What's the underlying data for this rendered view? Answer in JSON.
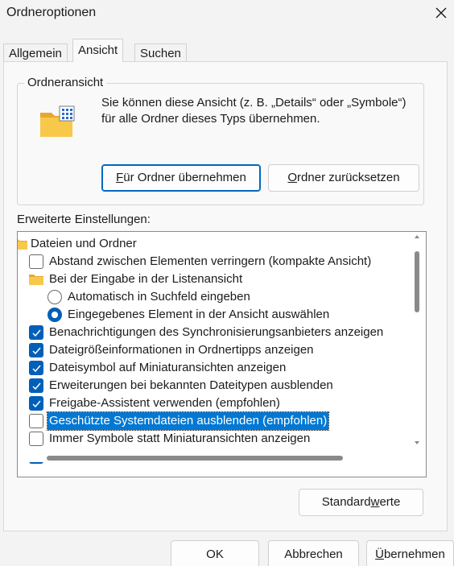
{
  "window": {
    "title": "Ordneroptionen"
  },
  "tabs": [
    {
      "label": "Allgemein"
    },
    {
      "label": "Ansicht"
    },
    {
      "label": "Suchen"
    }
  ],
  "folder_view": {
    "group_label": "Ordneransicht",
    "description": "Sie können diese Ansicht (z. B. „Details“ oder „Symbole“) für alle Ordner dieses Typs übernehmen.",
    "apply_button": {
      "prefix": "",
      "mnemonic": "F",
      "rest": "ür Ordner übernehmen"
    },
    "reset_button": {
      "prefix": "",
      "mnemonic": "O",
      "rest": "rdner zurücksetzen"
    }
  },
  "advanced": {
    "label": "Erweiterte Einstellungen:",
    "items": [
      {
        "type": "folder",
        "text": "Dateien und Ordner"
      },
      {
        "type": "checkbox",
        "checked": false,
        "text": "Abstand zwischen Elementen verringern (kompakte Ansicht)"
      },
      {
        "type": "folder",
        "text": "Bei der Eingabe in der Listenansicht"
      },
      {
        "type": "radio",
        "checked": false,
        "text": "Automatisch in Suchfeld eingeben"
      },
      {
        "type": "radio",
        "checked": true,
        "text": "Eingegebenes Element in der Ansicht auswählen"
      },
      {
        "type": "checkbox",
        "checked": true,
        "text": "Benachrichtigungen des Synchronisierungsanbieters anzeigen"
      },
      {
        "type": "checkbox",
        "checked": true,
        "text": "Dateigrößeinformationen in Ordnertipps anzeigen"
      },
      {
        "type": "checkbox",
        "checked": true,
        "text": "Dateisymbol auf Miniaturansichten anzeigen"
      },
      {
        "type": "checkbox",
        "checked": true,
        "text": "Erweiterungen bei bekannten Dateitypen ausblenden"
      },
      {
        "type": "checkbox",
        "checked": true,
        "text": "Freigabe-Assistent verwenden (empfohlen)"
      },
      {
        "type": "checkbox",
        "checked": false,
        "selected": true,
        "text": "Geschützte Systemdateien ausblenden (empfohlen)"
      },
      {
        "type": "checkbox",
        "checked": false,
        "text": "Immer Symbole statt Miniaturansichten anzeigen"
      },
      {
        "type": "checkbox",
        "checked": true,
        "text": ""
      }
    ],
    "defaults_button": {
      "prefix": "Standard",
      "mnemonic": "w",
      "rest": "erte"
    }
  },
  "footer": {
    "ok": "OK",
    "cancel": "Abbrechen",
    "apply": {
      "prefix": "",
      "mnemonic": "Ü",
      "rest": "bernehmen"
    }
  },
  "colors": {
    "accent": "#005fb8",
    "selection": "#0078d4"
  }
}
